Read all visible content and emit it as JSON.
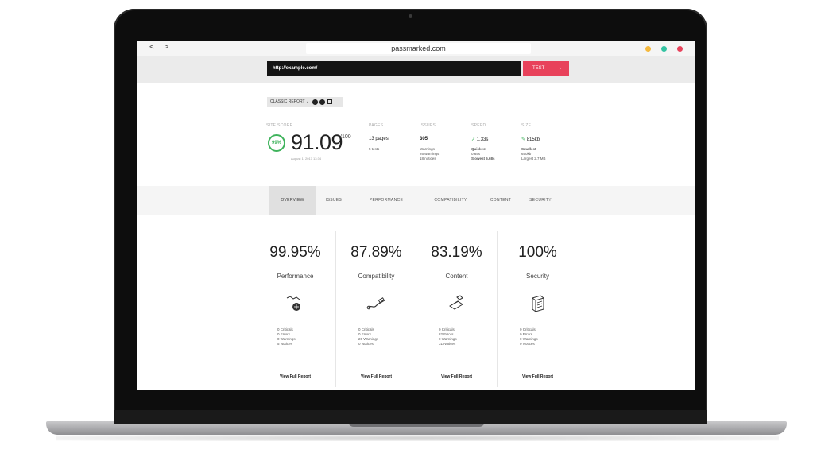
{
  "browser": {
    "nav_arrows": "< >",
    "title": "passmarked.com",
    "colors": {
      "yellow": "#f5b93e",
      "green": "#34c3a2",
      "red": "#e8425b"
    }
  },
  "search": {
    "value": "http://example.com/",
    "button_label": "TEST",
    "button_arrow": "›"
  },
  "summary": {
    "dropdown_label": "CLASSIC REPORT",
    "dropdown_caret": "⌄",
    "score_label": "SITE SCORE",
    "score_badge": "99%",
    "score": "91.09",
    "score_max": "/100",
    "score_date": "August 1, 2017 13:34",
    "pages": {
      "label": "PAGES",
      "value": "13 pages",
      "sub": [
        "5 tests"
      ]
    },
    "issues": {
      "label": "ISSUES",
      "value": "305",
      "sub": [
        "Warnings",
        "26 warnings",
        "18 notices"
      ]
    },
    "speed": {
      "label": "SPEED",
      "value": "1.33s",
      "sub": [
        "Quickest",
        "0.65s",
        "Slowest 5.68s"
      ]
    },
    "size": {
      "label": "SIZE",
      "value": "815kb",
      "sub": [
        "Smallest",
        "650kb",
        "Largest 2.7 MB"
      ]
    }
  },
  "tabs": [
    "OVERVIEW",
    "ISSUES",
    "PERFORMANCE",
    "COMPATIBILITY",
    "CONTENT",
    "SECURITY"
  ],
  "cards": [
    {
      "percent": "99.95%",
      "title": "Performance",
      "icon": "performance-icon",
      "counts": [
        "0 Criticals",
        "0 Errors",
        "0 Warnings",
        "5 Notices"
      ],
      "link": "View Full Report"
    },
    {
      "percent": "87.89%",
      "title": "Compatibility",
      "icon": "compatibility-icon",
      "counts": [
        "0 Criticals",
        "0 Errors",
        "26 Warnings",
        "0 Notices"
      ],
      "link": "View Full Report"
    },
    {
      "percent": "83.19%",
      "title": "Content",
      "icon": "content-icon",
      "counts": [
        "0 Criticals",
        "82 Errors",
        "0 Warnings",
        "31 Notices"
      ],
      "link": "View Full Report"
    },
    {
      "percent": "100%",
      "title": "Security",
      "icon": "security-icon",
      "counts": [
        "0 Criticals",
        "0 Errors",
        "0 Warnings",
        "0 Notices"
      ],
      "link": "View Full Report"
    }
  ]
}
